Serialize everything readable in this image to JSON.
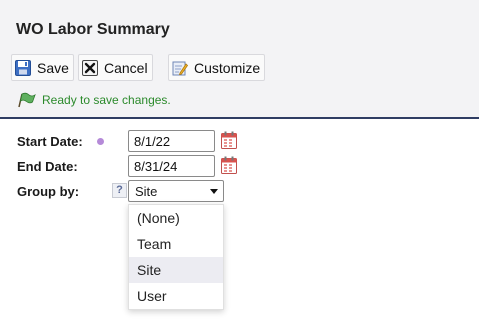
{
  "page": {
    "title": "WO Labor Summary"
  },
  "toolbar": {
    "save_label": "Save",
    "cancel_label": "Cancel",
    "customize_label": "Customize"
  },
  "status": {
    "message": "Ready to save changes.",
    "color": "#2b8a2b"
  },
  "form": {
    "start_date_label": "Start Date:",
    "start_date_value": "8/1/22",
    "end_date_label": "End Date:",
    "end_date_value": "8/31/24",
    "group_by_label": "Group by:",
    "group_by_value": "Site",
    "help_glyph": "?",
    "group_by_options": [
      "(None)",
      "Team",
      "Site",
      "User"
    ]
  },
  "icons": {
    "save": "floppy-disk-icon",
    "cancel": "x-box-icon",
    "customize": "edit-document-icon",
    "status": "green-flag-icon",
    "calendar": "calendar-icon",
    "help": "help-icon",
    "required": "required-dot"
  },
  "colors": {
    "divider": "#2f3d63",
    "required_dot": "#b58ad8",
    "selected_option_bg": "#ececf2"
  }
}
